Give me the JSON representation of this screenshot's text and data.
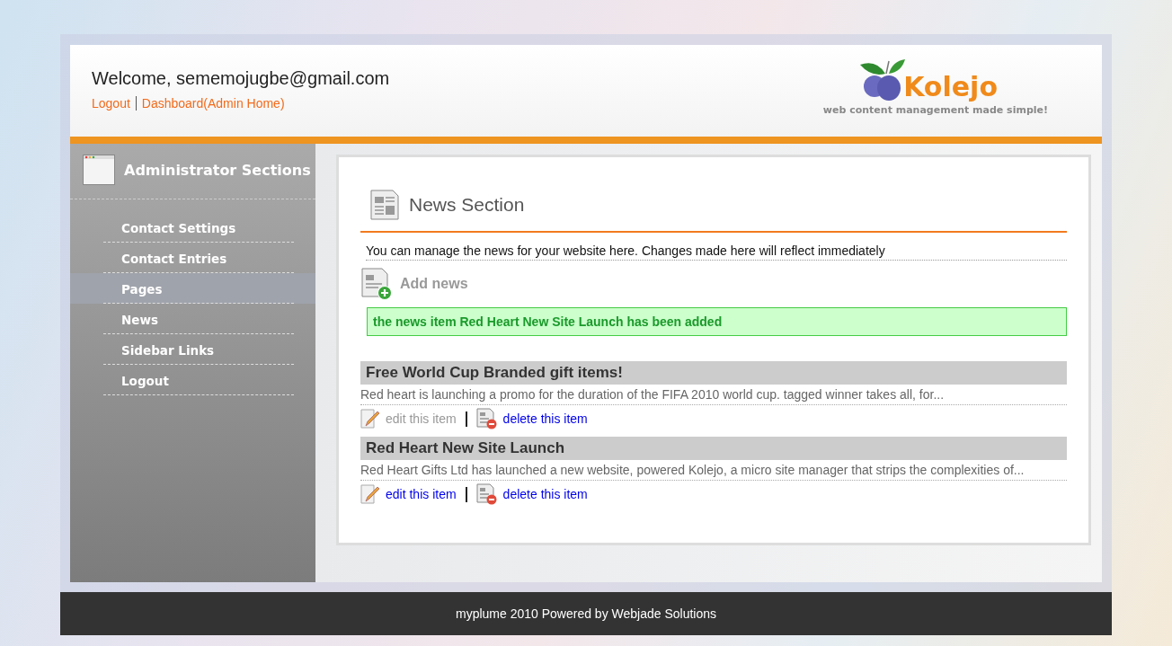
{
  "header": {
    "welcome": "Welcome, sememojugbe@gmail.com",
    "links": [
      {
        "label": "Logout"
      },
      {
        "label": "Dashboard(Admin Home)"
      }
    ],
    "logo": {
      "name": "Kolejo",
      "tagline": "web content management made simple!"
    }
  },
  "sidebar": {
    "title": "Administrator Sections",
    "items": [
      {
        "label": "Contact Settings",
        "selected": false
      },
      {
        "label": "Contact Entries",
        "selected": false
      },
      {
        "label": "Pages",
        "selected": true
      },
      {
        "label": "News",
        "selected": false
      },
      {
        "label": "Sidebar Links",
        "selected": false
      },
      {
        "label": "Logout",
        "selected": false
      }
    ]
  },
  "main": {
    "title": "News Section",
    "intro": "You can manage the news for your website here. Changes made here will reflect immediately",
    "add_label": "Add news",
    "message": "the news item Red Heart New Site Launch has been added",
    "news": [
      {
        "title": "Free World Cup Branded gift items!",
        "summary": "Red heart is launching a promo for the duration of the FIFA 2010 world cup. tagged winner takes all, for...",
        "edit": {
          "label": "edit this item",
          "visited": true
        },
        "delete": {
          "label": "delete this item",
          "visited": false
        }
      },
      {
        "title": "Red Heart New Site Launch",
        "summary": "Red Heart Gifts Ltd has launched a new website, powered Kolejo, a micro site manager that strips the complexities of...",
        "edit": {
          "label": "edit this item",
          "visited": false
        },
        "delete": {
          "label": "delete this item",
          "visited": false
        }
      }
    ]
  },
  "footer": "myplume 2010 Powered by Webjade Solutions"
}
